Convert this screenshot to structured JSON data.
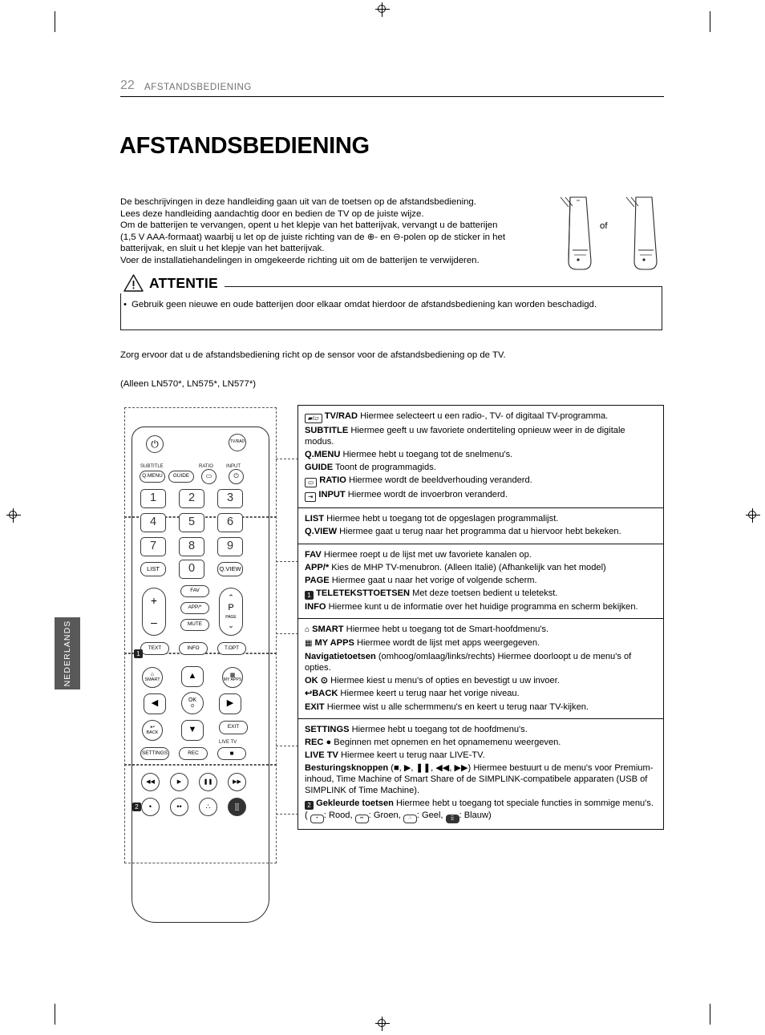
{
  "header": {
    "page_number": "22",
    "section": "AFSTANDSBEDIENING",
    "title": "AFSTANDSBEDIENING",
    "side_tab": "NEDERLANDS"
  },
  "intro": {
    "line1": "De beschrijvingen in deze handleiding gaan uit van de toetsen op de afstandsbediening.",
    "line2": "Lees deze handleiding aandachtig door en bedien de TV op de juiste wijze.",
    "line3": "Om de batterijen te vervangen, opent u het klepje van het batterijvak, vervangt u de batterijen",
    "line4": "(1,5 V AAA-formaat) waarbij u let op de juiste richting van de ⊕- en ⊖-polen op de sticker in het",
    "line5": "batterijvak, en sluit u het klepje van het batterijvak.",
    "line6": "Voer de installatiehandelingen in omgekeerde richting uit om de batterijen te verwijderen.",
    "of_label": "of"
  },
  "attention": {
    "title": "ATTENTIE",
    "bullet": "•",
    "text": "Gebruik geen nieuwe en oude batterijen door elkaar omdat hierdoor de afstandsbediening kan worden beschadigd."
  },
  "paragraphs": {
    "sensor": "Zorg ervoor dat u de afstandsbediening richt op de sensor voor de afstandsbediening op de TV.",
    "models": "(Alleen  LN570*, LN575*, LN577*)"
  },
  "remote": {
    "buttons": {
      "power": "⏻",
      "tvrad_top": "TV/RAD",
      "subtitle": "SUBTITLE",
      "qmenu": "Q.MENU",
      "guide": "GUIDE",
      "ratio": "RATIO",
      "input": "INPUT",
      "n1": "1",
      "n2": "2",
      "n3": "3",
      "n4": "4",
      "n5": "5",
      "n6": "6",
      "n7": "7",
      "n8": "8",
      "n9": "9",
      "list": "LIST",
      "n0": "0",
      "qview": "Q.VIEW",
      "fav": "FAV",
      "app": "APP/*",
      "mute": "MUTE",
      "page": "P",
      "page_label": "PAGE",
      "text": "TEXT",
      "info": "INFO",
      "topt": "T.OPT",
      "smart": "SMART",
      "myapps": "MY APPS",
      "ok": "OK",
      "back": "BACK",
      "exit": "EXIT",
      "livetv": "LIVE TV",
      "settings": "SETTINGS",
      "rec": "REC",
      "stop": "■",
      "rew": "◀◀",
      "play": "▶",
      "pause": "❚❚",
      "ff": "▶▶",
      "badge1": "1",
      "badge2": "2"
    }
  },
  "descriptions": [
    {
      "id": "group-1",
      "items": [
        {
          "icon": "tvrad-icon",
          "label": "TV/RAD",
          "text": " Hiermee selecteert u een radio-, TV- of digitaal TV-programma."
        },
        {
          "label": "SUBTITLE",
          "text": " Hiermee geeft u uw favoriete ondertiteling opnieuw weer in de digitale modus."
        },
        {
          "label": "Q.MENU",
          "text": " Hiermee hebt u toegang tot de snelmenu's."
        },
        {
          "label": "GUIDE",
          "text": " Toont de programmagids."
        },
        {
          "icon": "ratio-icon",
          "label": "RATIO",
          "text": " Hiermee wordt de beeldverhouding veranderd."
        },
        {
          "icon": "input-icon",
          "label": "INPUT",
          "text": " Hiermee wordt de invoerbron veranderd."
        }
      ]
    },
    {
      "id": "group-2",
      "items": [
        {
          "label": "LIST",
          "text": " Hiermee hebt u toegang tot de opgeslagen programmalijst."
        },
        {
          "label": "Q.VIEW",
          "text": " Hiermee gaat u terug naar het programma dat u hiervoor hebt bekeken."
        }
      ]
    },
    {
      "id": "group-3",
      "items": [
        {
          "label": "FAV",
          "text": " Hiermee roept u de lijst met uw favoriete kanalen op."
        },
        {
          "label": "APP/*",
          "text": " Kies de MHP TV-menubron. (Alleen Italië) (Afhankelijk van het model)"
        },
        {
          "label": "PAGE",
          "text": " Hiermee gaat u naar het vorige of volgende scherm."
        },
        {
          "badge": "1",
          "label": "TELETEKSTTOETSEN",
          "text": " Met deze toetsen bedient u teletekst."
        },
        {
          "label": "INFO",
          "text": " Hiermee kunt u de informatie over het huidige programma en scherm bekijken."
        }
      ]
    },
    {
      "id": "group-4",
      "items": [
        {
          "icon": "home-icon",
          "label": "SMART",
          "text": " Hiermee hebt u toegang tot de Smart-hoofdmenu's."
        },
        {
          "icon": "grid-icon",
          "label": "MY APPS",
          "text": " Hiermee wordt de lijst met apps weergegeven."
        },
        {
          "label": "Navigatietoetsen",
          "text": " (omhoog/omlaag/links/rechts) Hiermee doorloopt u de menu's of opties."
        },
        {
          "label": "OK ⊙",
          "text": " Hiermee kiest u menu's of opties en bevestigt u uw invoer."
        },
        {
          "label": "↩BACK",
          "text": " Hiermee keert u terug naar het vorige niveau."
        },
        {
          "label": "EXIT",
          "text": "  Hiermee wist u alle schermmenu's en keert u terug naar TV-kijken."
        }
      ]
    },
    {
      "id": "group-5",
      "items": [
        {
          "label": "SETTINGS",
          "text": " Hiermee hebt u toegang tot de hoofdmenu's."
        },
        {
          "label": "REC ●",
          "text": " Beginnen met opnemen en het opnamemenu weergeven."
        },
        {
          "label": "LIVE TV",
          "text": " Hiermee keert u terug naar LIVE-TV."
        },
        {
          "label": "Besturingsknoppen",
          "text": " (■, ▶, ❚❚, ◀◀, ▶▶) Hiermee bestuurt u de menu's voor Premium-inhoud, Time Machine of Smart Share of de SIMPLINK-compatibele apparaten (USB of SIMPLINK of Time Machine)."
        },
        {
          "badge": "2",
          "label": "Gekleurde toetsen",
          "text": " Hiermee hebt u toegang tot speciale functies in sommige menu's. (",
          "colors": [
            {
              "swatch": "•",
              "name": ": Rood, "
            },
            {
              "swatch": "••",
              "name": ": Groen, "
            },
            {
              "swatch": "∴",
              "name": ": Geel, "
            },
            {
              "swatch": "⣿",
              "name": ": Blauw)"
            }
          ]
        }
      ]
    }
  ]
}
